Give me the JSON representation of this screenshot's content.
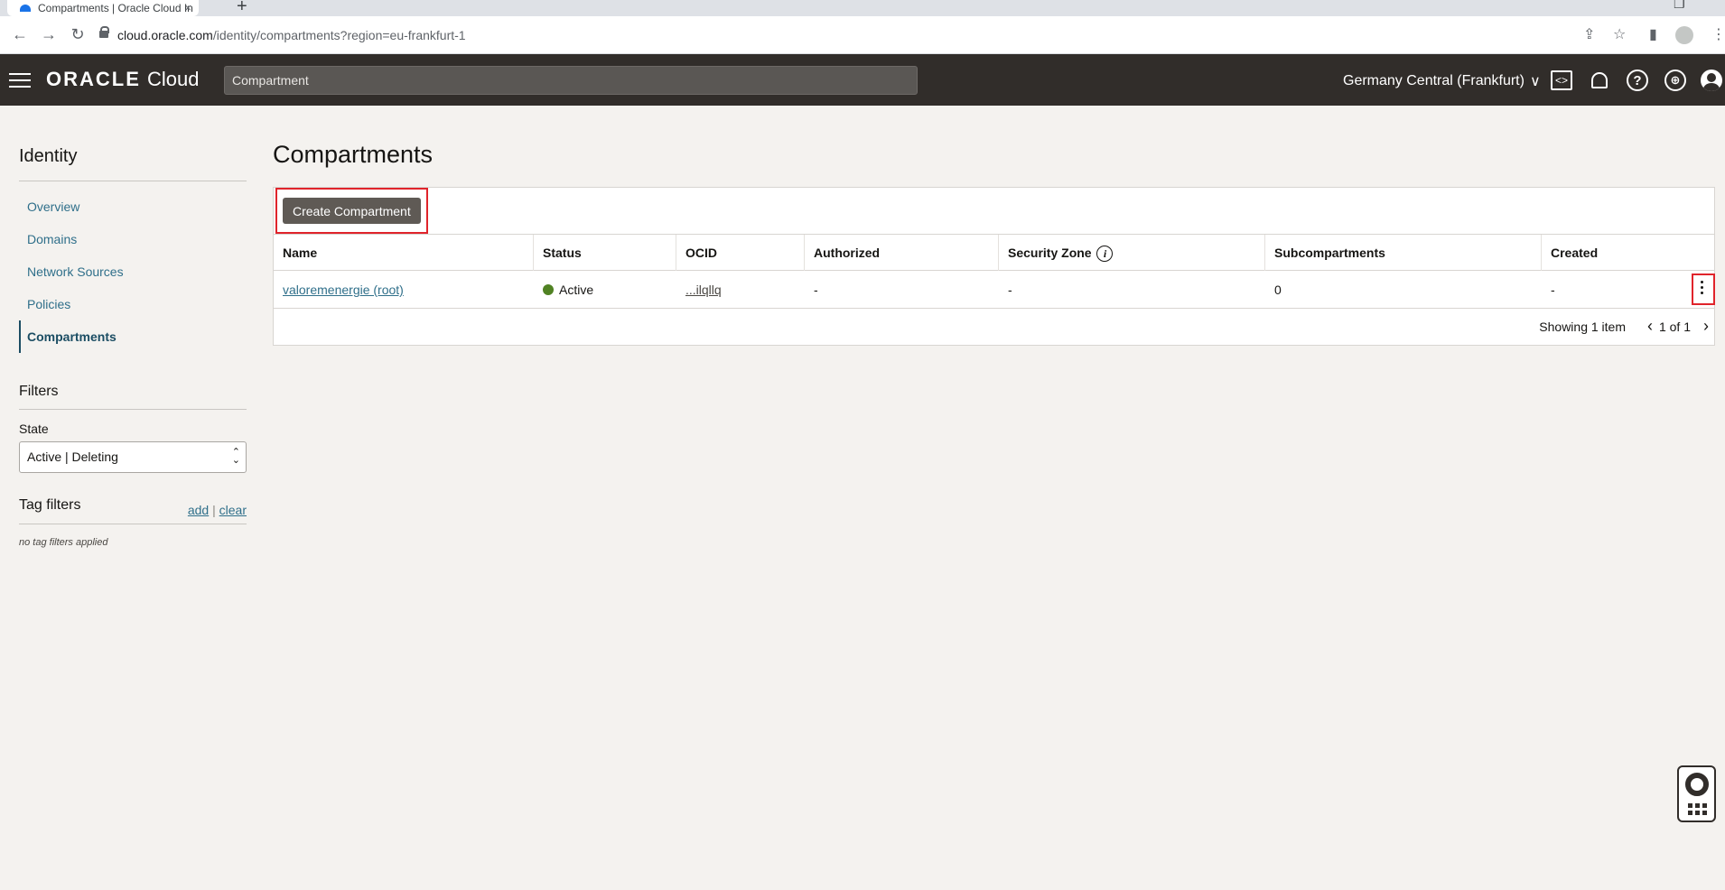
{
  "browser": {
    "tab_title": "Compartments | Oracle Cloud In",
    "tab_close": "×",
    "new_tab": "+",
    "url_host": "cloud.oracle.com",
    "url_path": "/identity/compartments?region=eu-frankfurt-1",
    "nav_back": "←",
    "nav_forward": "→",
    "nav_reload": "↻"
  },
  "header": {
    "brand_oracle": "ORACLE",
    "brand_cloud": "Cloud",
    "search_value": "Compartment",
    "region": "Germany Central (Frankfurt)",
    "region_chevron": "∨",
    "icons": [
      "code-editor-icon",
      "bell-icon",
      "help-icon",
      "globe-icon",
      "user-icon"
    ]
  },
  "sidebar": {
    "title": "Identity",
    "items": [
      {
        "label": "Overview"
      },
      {
        "label": "Domains"
      },
      {
        "label": "Network Sources"
      },
      {
        "label": "Policies"
      },
      {
        "label": "Compartments",
        "active": true
      }
    ],
    "filters_title": "Filters",
    "state_label": "State",
    "state_value": "Active | Deleting",
    "tag_filters_title": "Tag filters",
    "tag_add": "add",
    "tag_separator": "|",
    "tag_clear": "clear",
    "tag_note": "no tag filters applied"
  },
  "main": {
    "title": "Compartments",
    "create_button": "Create Compartment",
    "columns": [
      "Name",
      "Status",
      "OCID",
      "Authorized",
      "Security Zone",
      "Subcompartments",
      "Created"
    ],
    "info_glyph": "i",
    "rows": [
      {
        "name": "valoremenergie (root)",
        "status": "Active",
        "ocid": "...ilqllq",
        "authorized": "-",
        "security_zone": "-",
        "subcompartments": "0",
        "created": "-"
      }
    ],
    "pager_text": "Showing 1 item",
    "pager_count": "1 of 1",
    "pager_prev": "‹",
    "pager_next": "›"
  },
  "colors": {
    "header_bg": "#312d2a",
    "link": "#2f6f8a",
    "status_active": "#508223",
    "highlight": "#e0242b",
    "primary_button": "#5f5a55"
  }
}
